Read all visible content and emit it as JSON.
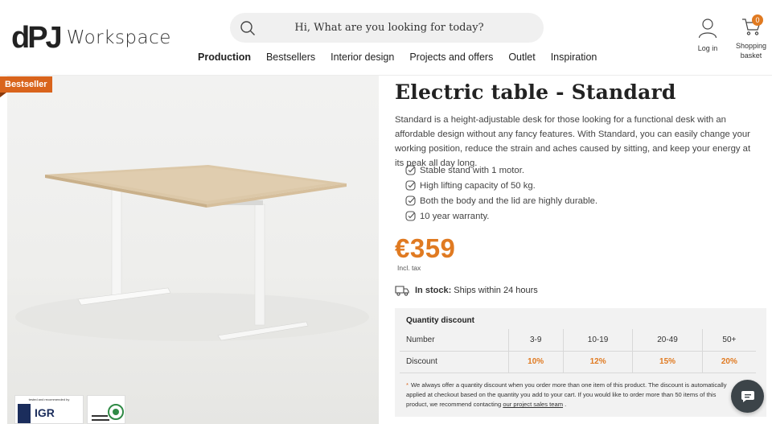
{
  "brand": {
    "mark": "dPJ",
    "name": "Workspace"
  },
  "search": {
    "placeholder": "Hi, What are you looking for today?"
  },
  "account": {
    "label": "Log in"
  },
  "basket": {
    "label_line1": "Shopping",
    "label_line2": "basket",
    "count": "0"
  },
  "nav": {
    "items": [
      {
        "label": "Production",
        "active": true
      },
      {
        "label": "Bestsellers"
      },
      {
        "label": "Interior design"
      },
      {
        "label": "Projects and offers"
      },
      {
        "label": "Outlet"
      },
      {
        "label": "Inspiration"
      }
    ]
  },
  "hero": {
    "badge": "Bestseller",
    "cert1": {
      "top_text": "tested and recommended by",
      "logo": "IGR"
    }
  },
  "product": {
    "title": "Electric table - Standard",
    "description": "Standard is a height-adjustable desk for those looking for a functional desk with an affordable design without any fancy features. With Standard, you can easily change your working position, reduce the strain and aches caused by sitting, and keep your energy at its peak all day long.",
    "features": [
      "Stable stand with 1 motor.",
      "High lifting capacity of 50 kg.",
      "Both the body and the lid are highly durable.",
      "10 year warranty."
    ],
    "price": "€359",
    "tax_note": "Incl. tax",
    "stock_label": "In stock:",
    "stock_text": "Ships within 24 hours"
  },
  "quantity_discount": {
    "title": "Quantity discount",
    "number_label": "Number",
    "discount_label": "Discount",
    "ranges": [
      "3-9",
      "10-19",
      "20-49",
      "50+"
    ],
    "discounts": [
      "10%",
      "12%",
      "15%",
      "20%"
    ],
    "note_star": "*",
    "note_text": "We always offer a quantity discount when you order more than one item of this product. The discount is automatically applied at checkout based on the quantity you add to your cart. If you would like to order more than 50 items of this product, we recommend contacting",
    "note_link": "our project sales team",
    "note_end": "."
  },
  "colors": {
    "accent": "#e07a21",
    "badge": "#d9641c",
    "chat": "#3c4449"
  },
  "icons": [
    "search-icon",
    "user-icon",
    "cart-icon",
    "check-icon",
    "truck-icon",
    "chat-icon"
  ]
}
